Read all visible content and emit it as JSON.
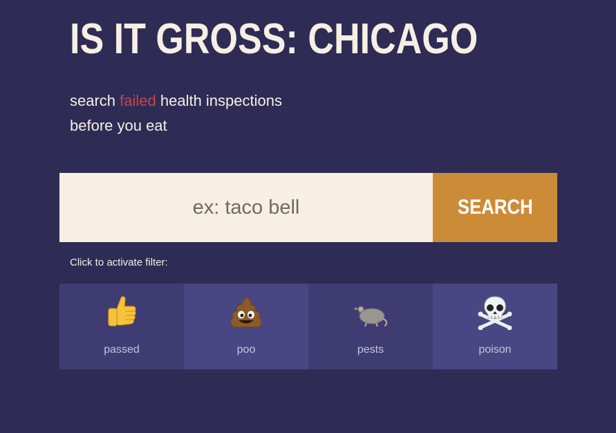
{
  "header": {
    "title": "IS IT GROSS: CHICAGO",
    "tagline_part1": "search ",
    "tagline_highlight": "failed",
    "tagline_part2": " health inspections",
    "tagline_line2": "before you eat"
  },
  "search": {
    "placeholder": "ex: taco bell",
    "value": "",
    "button_label": "SEARCH"
  },
  "filters": {
    "caption": "Click to activate filter:",
    "items": [
      {
        "label": "passed",
        "icon": "thumbs-up-icon"
      },
      {
        "label": "poo",
        "icon": "poo-icon"
      },
      {
        "label": "pests",
        "icon": "rat-icon"
      },
      {
        "label": "poison",
        "icon": "skull-crossbones-icon"
      }
    ]
  },
  "colors": {
    "background": "#2e2c55",
    "text": "#f7efe3",
    "failed_accent": "#c9434a",
    "search_button": "#cc8c37",
    "filter_dark": "#3e3c72",
    "filter_light": "#484683"
  }
}
